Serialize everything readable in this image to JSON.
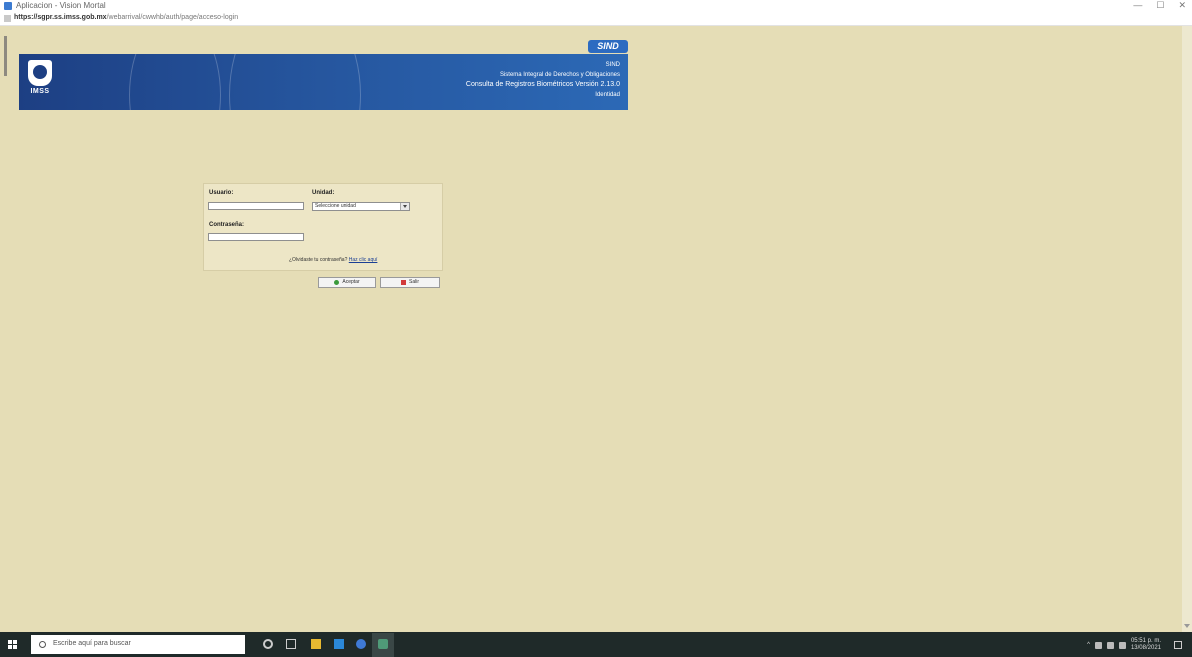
{
  "browser": {
    "window_title": "Aplicacion - Vision Mortal",
    "window_controls": [
      "—",
      "☐",
      "✕"
    ],
    "url_prefix": "https://sgpr.ss.imss.gob.mx",
    "url_rest": "/webarrival/cwwhb/auth/page/acceso-login"
  },
  "banner": {
    "logo_text": "IMSS",
    "brand_badge": "SIND",
    "line1": "SIND",
    "line2": "Sistema Integral de Derechos y Obligaciones",
    "line3": "Consulta de Registros Biométricos   Versión 2.13.0",
    "line4": "Identidad"
  },
  "login": {
    "usuario_label": "Usuario:",
    "usuario_value": "",
    "unidad_label": "Unidad:",
    "unidad_value": "Seleccione unidad",
    "contrasena_label": "Contraseña:",
    "contrasena_value": "",
    "forgot_text": "¿Olvidaste tu contraseña?",
    "forgot_link": "Haz clic aquí",
    "ok_button": "Aceptar",
    "exit_button": "Salir"
  },
  "taskbar": {
    "search_placeholder": "Escribe aquí para buscar",
    "clock_time": "05:51 p. m.",
    "clock_date": "13/08/2021"
  },
  "colors": {
    "page_background": "#e5ddb6",
    "banner_blue": "#25549c",
    "taskbar": "#1f2a29"
  },
  "icons": [
    "windows-start-icon",
    "search-icon",
    "cortana-icon",
    "task-view-icon",
    "file-explorer-icon",
    "store-icon",
    "internet-explorer-icon",
    "app-icon",
    "network-icon",
    "volume-icon",
    "notification-icon"
  ]
}
